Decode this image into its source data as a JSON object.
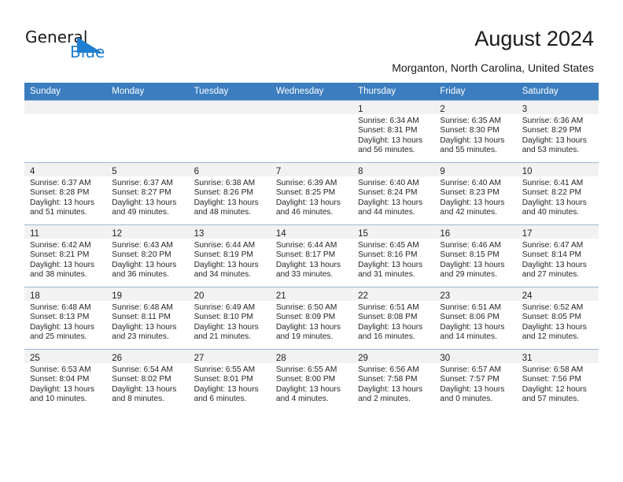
{
  "brand": {
    "word1": "General",
    "word2": "Blue",
    "mark_icon": "triangle-logo-icon",
    "blue": "#1f7fd0"
  },
  "header": {
    "title": "August 2024",
    "location": "Morganton, North Carolina, United States"
  },
  "calendar": {
    "header_bg": "#3b7dbf",
    "weekdays": [
      "Sunday",
      "Monday",
      "Tuesday",
      "Wednesday",
      "Thursday",
      "Friday",
      "Saturday"
    ],
    "weeks": [
      [
        {
          "day": "",
          "sunrise": "",
          "sunset": "",
          "daylight1": "",
          "daylight2": ""
        },
        {
          "day": "",
          "sunrise": "",
          "sunset": "",
          "daylight1": "",
          "daylight2": ""
        },
        {
          "day": "",
          "sunrise": "",
          "sunset": "",
          "daylight1": "",
          "daylight2": ""
        },
        {
          "day": "",
          "sunrise": "",
          "sunset": "",
          "daylight1": "",
          "daylight2": ""
        },
        {
          "day": "1",
          "sunrise": "Sunrise: 6:34 AM",
          "sunset": "Sunset: 8:31 PM",
          "daylight1": "Daylight: 13 hours",
          "daylight2": "and 56 minutes."
        },
        {
          "day": "2",
          "sunrise": "Sunrise: 6:35 AM",
          "sunset": "Sunset: 8:30 PM",
          "daylight1": "Daylight: 13 hours",
          "daylight2": "and 55 minutes."
        },
        {
          "day": "3",
          "sunrise": "Sunrise: 6:36 AM",
          "sunset": "Sunset: 8:29 PM",
          "daylight1": "Daylight: 13 hours",
          "daylight2": "and 53 minutes."
        }
      ],
      [
        {
          "day": "4",
          "sunrise": "Sunrise: 6:37 AM",
          "sunset": "Sunset: 8:28 PM",
          "daylight1": "Daylight: 13 hours",
          "daylight2": "and 51 minutes."
        },
        {
          "day": "5",
          "sunrise": "Sunrise: 6:37 AM",
          "sunset": "Sunset: 8:27 PM",
          "daylight1": "Daylight: 13 hours",
          "daylight2": "and 49 minutes."
        },
        {
          "day": "6",
          "sunrise": "Sunrise: 6:38 AM",
          "sunset": "Sunset: 8:26 PM",
          "daylight1": "Daylight: 13 hours",
          "daylight2": "and 48 minutes."
        },
        {
          "day": "7",
          "sunrise": "Sunrise: 6:39 AM",
          "sunset": "Sunset: 8:25 PM",
          "daylight1": "Daylight: 13 hours",
          "daylight2": "and 46 minutes."
        },
        {
          "day": "8",
          "sunrise": "Sunrise: 6:40 AM",
          "sunset": "Sunset: 8:24 PM",
          "daylight1": "Daylight: 13 hours",
          "daylight2": "and 44 minutes."
        },
        {
          "day": "9",
          "sunrise": "Sunrise: 6:40 AM",
          "sunset": "Sunset: 8:23 PM",
          "daylight1": "Daylight: 13 hours",
          "daylight2": "and 42 minutes."
        },
        {
          "day": "10",
          "sunrise": "Sunrise: 6:41 AM",
          "sunset": "Sunset: 8:22 PM",
          "daylight1": "Daylight: 13 hours",
          "daylight2": "and 40 minutes."
        }
      ],
      [
        {
          "day": "11",
          "sunrise": "Sunrise: 6:42 AM",
          "sunset": "Sunset: 8:21 PM",
          "daylight1": "Daylight: 13 hours",
          "daylight2": "and 38 minutes."
        },
        {
          "day": "12",
          "sunrise": "Sunrise: 6:43 AM",
          "sunset": "Sunset: 8:20 PM",
          "daylight1": "Daylight: 13 hours",
          "daylight2": "and 36 minutes."
        },
        {
          "day": "13",
          "sunrise": "Sunrise: 6:44 AM",
          "sunset": "Sunset: 8:19 PM",
          "daylight1": "Daylight: 13 hours",
          "daylight2": "and 34 minutes."
        },
        {
          "day": "14",
          "sunrise": "Sunrise: 6:44 AM",
          "sunset": "Sunset: 8:17 PM",
          "daylight1": "Daylight: 13 hours",
          "daylight2": "and 33 minutes."
        },
        {
          "day": "15",
          "sunrise": "Sunrise: 6:45 AM",
          "sunset": "Sunset: 8:16 PM",
          "daylight1": "Daylight: 13 hours",
          "daylight2": "and 31 minutes."
        },
        {
          "day": "16",
          "sunrise": "Sunrise: 6:46 AM",
          "sunset": "Sunset: 8:15 PM",
          "daylight1": "Daylight: 13 hours",
          "daylight2": "and 29 minutes."
        },
        {
          "day": "17",
          "sunrise": "Sunrise: 6:47 AM",
          "sunset": "Sunset: 8:14 PM",
          "daylight1": "Daylight: 13 hours",
          "daylight2": "and 27 minutes."
        }
      ],
      [
        {
          "day": "18",
          "sunrise": "Sunrise: 6:48 AM",
          "sunset": "Sunset: 8:13 PM",
          "daylight1": "Daylight: 13 hours",
          "daylight2": "and 25 minutes."
        },
        {
          "day": "19",
          "sunrise": "Sunrise: 6:48 AM",
          "sunset": "Sunset: 8:11 PM",
          "daylight1": "Daylight: 13 hours",
          "daylight2": "and 23 minutes."
        },
        {
          "day": "20",
          "sunrise": "Sunrise: 6:49 AM",
          "sunset": "Sunset: 8:10 PM",
          "daylight1": "Daylight: 13 hours",
          "daylight2": "and 21 minutes."
        },
        {
          "day": "21",
          "sunrise": "Sunrise: 6:50 AM",
          "sunset": "Sunset: 8:09 PM",
          "daylight1": "Daylight: 13 hours",
          "daylight2": "and 19 minutes."
        },
        {
          "day": "22",
          "sunrise": "Sunrise: 6:51 AM",
          "sunset": "Sunset: 8:08 PM",
          "daylight1": "Daylight: 13 hours",
          "daylight2": "and 16 minutes."
        },
        {
          "day": "23",
          "sunrise": "Sunrise: 6:51 AM",
          "sunset": "Sunset: 8:06 PM",
          "daylight1": "Daylight: 13 hours",
          "daylight2": "and 14 minutes."
        },
        {
          "day": "24",
          "sunrise": "Sunrise: 6:52 AM",
          "sunset": "Sunset: 8:05 PM",
          "daylight1": "Daylight: 13 hours",
          "daylight2": "and 12 minutes."
        }
      ],
      [
        {
          "day": "25",
          "sunrise": "Sunrise: 6:53 AM",
          "sunset": "Sunset: 8:04 PM",
          "daylight1": "Daylight: 13 hours",
          "daylight2": "and 10 minutes."
        },
        {
          "day": "26",
          "sunrise": "Sunrise: 6:54 AM",
          "sunset": "Sunset: 8:02 PM",
          "daylight1": "Daylight: 13 hours",
          "daylight2": "and 8 minutes."
        },
        {
          "day": "27",
          "sunrise": "Sunrise: 6:55 AM",
          "sunset": "Sunset: 8:01 PM",
          "daylight1": "Daylight: 13 hours",
          "daylight2": "and 6 minutes."
        },
        {
          "day": "28",
          "sunrise": "Sunrise: 6:55 AM",
          "sunset": "Sunset: 8:00 PM",
          "daylight1": "Daylight: 13 hours",
          "daylight2": "and 4 minutes."
        },
        {
          "day": "29",
          "sunrise": "Sunrise: 6:56 AM",
          "sunset": "Sunset: 7:58 PM",
          "daylight1": "Daylight: 13 hours",
          "daylight2": "and 2 minutes."
        },
        {
          "day": "30",
          "sunrise": "Sunrise: 6:57 AM",
          "sunset": "Sunset: 7:57 PM",
          "daylight1": "Daylight: 13 hours",
          "daylight2": "and 0 minutes."
        },
        {
          "day": "31",
          "sunrise": "Sunrise: 6:58 AM",
          "sunset": "Sunset: 7:56 PM",
          "daylight1": "Daylight: 12 hours",
          "daylight2": "and 57 minutes."
        }
      ]
    ]
  }
}
